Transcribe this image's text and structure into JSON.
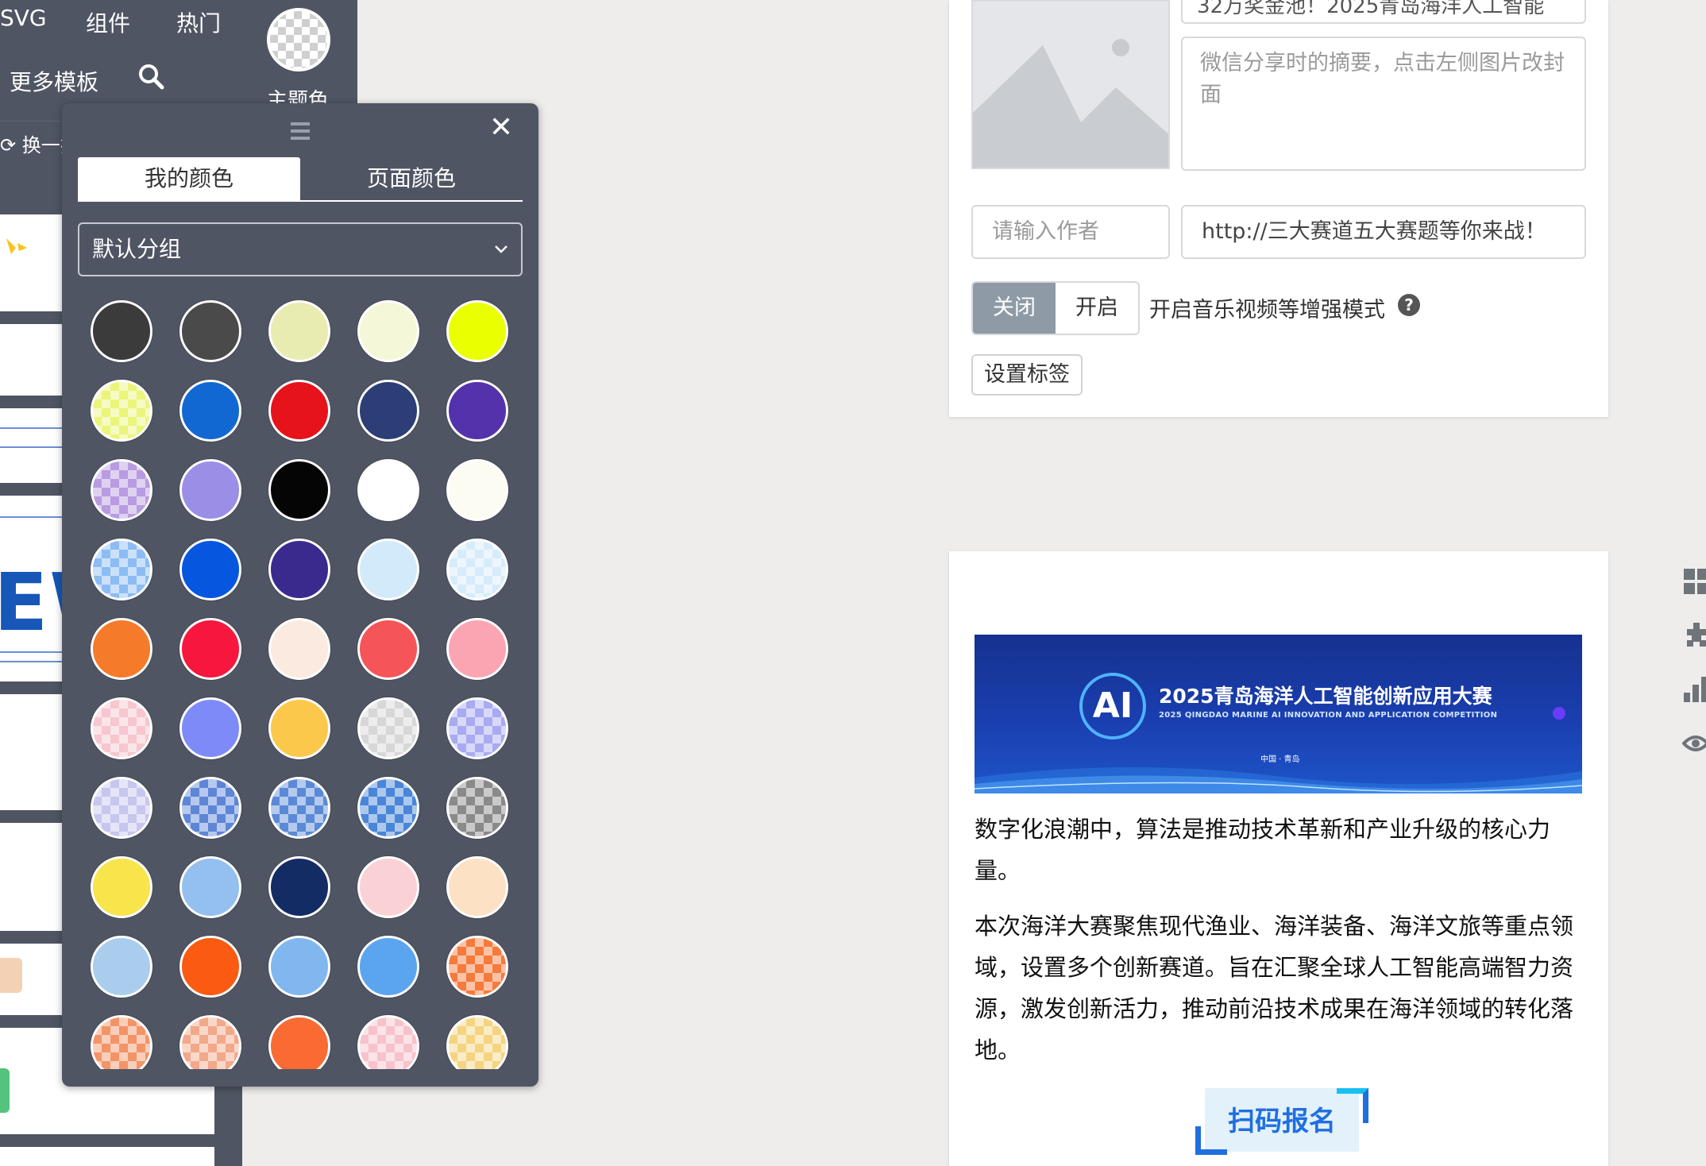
{
  "toolbar": {
    "svg_label": "SVG",
    "components_label": "组件",
    "hot_label": "热门",
    "more_templates_label": "更多模板",
    "theme_color_label": "主题色",
    "refresh_label": "换一换"
  },
  "left_preview": {
    "ews_text": "EWS"
  },
  "color_picker": {
    "tabs": [
      "我的颜色",
      "页面颜色"
    ],
    "active_tab": 0,
    "group_select_value": "默认分组",
    "swatches": [
      {
        "color": "#3b3b3b",
        "pattern": false
      },
      {
        "color": "#4a4a4a",
        "pattern": false
      },
      {
        "color": "#e9ecb0",
        "pattern": false
      },
      {
        "color": "#f5f7d9",
        "pattern": false
      },
      {
        "color": "#eaff00",
        "pattern": false
      },
      {
        "color": "#eaf57a",
        "pattern": true
      },
      {
        "color": "#1268d3",
        "pattern": false
      },
      {
        "color": "#e6131b",
        "pattern": false
      },
      {
        "color": "#2c3e75",
        "pattern": false
      },
      {
        "color": "#5432ac",
        "pattern": false
      },
      {
        "color": "#b89be0",
        "pattern": true
      },
      {
        "color": "#9b8ee6",
        "pattern": false
      },
      {
        "color": "#050505",
        "pattern": false
      },
      {
        "color": "#ffffff",
        "pattern": false
      },
      {
        "color": "#fdfcf3",
        "pattern": false
      },
      {
        "color": "#8cbcf3",
        "pattern": true
      },
      {
        "color": "#0656e0",
        "pattern": false
      },
      {
        "color": "#3a2a8e",
        "pattern": false
      },
      {
        "color": "#d3eafa",
        "pattern": false
      },
      {
        "color": "#d6ecfb",
        "pattern": true
      },
      {
        "color": "#f57a2a",
        "pattern": false
      },
      {
        "color": "#f7163d",
        "pattern": false
      },
      {
        "color": "#fbeadf",
        "pattern": false
      },
      {
        "color": "#f55459",
        "pattern": false
      },
      {
        "color": "#fba5b2",
        "pattern": false
      },
      {
        "color": "#f7c6cf",
        "pattern": true
      },
      {
        "color": "#7e8af7",
        "pattern": false
      },
      {
        "color": "#fcc84b",
        "pattern": false
      },
      {
        "color": "#d7d7d7",
        "pattern": true
      },
      {
        "color": "#a9aaf1",
        "pattern": true
      },
      {
        "color": "#c6c6ee",
        "pattern": true
      },
      {
        "color": "#5e86d6",
        "pattern": true
      },
      {
        "color": "#5a8ad7",
        "pattern": true
      },
      {
        "color": "#4a86d8",
        "pattern": true
      },
      {
        "color": "#8a8a8a",
        "pattern": true
      },
      {
        "color": "#f8e54b",
        "pattern": false
      },
      {
        "color": "#93c0ee",
        "pattern": false
      },
      {
        "color": "#142c64",
        "pattern": false
      },
      {
        "color": "#fad2d6",
        "pattern": false
      },
      {
        "color": "#fde1c4",
        "pattern": false
      },
      {
        "color": "#aacdee",
        "pattern": false
      },
      {
        "color": "#fa5a12",
        "pattern": false
      },
      {
        "color": "#81b7ef",
        "pattern": false
      },
      {
        "color": "#5ba5ef",
        "pattern": false
      },
      {
        "color": "#f57a3c",
        "pattern": true
      },
      {
        "color": "#f29468",
        "pattern": true
      },
      {
        "color": "#f2a88a",
        "pattern": true
      },
      {
        "color": "#f96b32",
        "pattern": false
      },
      {
        "color": "#f7c2cb",
        "pattern": true
      },
      {
        "color": "#f4d480",
        "pattern": true
      }
    ]
  },
  "share_settings": {
    "title_value": "32万奖金池！2025青岛海洋人工智能",
    "summary_placeholder": "微信分享时的摘要，点击左侧图片改封面",
    "author_placeholder": "请输入作者",
    "link_value": "http://三大赛道五大赛题等你来战！",
    "toggle_off_label": "关闭",
    "toggle_on_label": "开启",
    "toggle_state": "off",
    "enhance_label": "开启音乐视频等增强模式",
    "tag_button_label": "设置标签"
  },
  "article": {
    "banner": {
      "logo_text": "AI",
      "title": "2025青岛海洋人工智能创新应用大赛",
      "subtitle": "2025 QINGDAO MARINE AI INNOVATION AND APPLICATION COMPETITION",
      "place": "中国 · 青岛"
    },
    "para1": "数字化浪潮中，算法是推动技术革新和产业升级的核心力量。",
    "para2": "本次海洋大赛聚焦现代渔业、海洋装备、海洋文旅等重点领域，设置多个创新赛道。旨在汇聚全球人工智能高端智力资源，激发创新活力，推动前沿技术成果在海洋领域的转化落地。",
    "scan_button_label": "扫码报名"
  },
  "side_tools": [
    "grid-icon",
    "puzzle-icon",
    "bar-chart-icon",
    "eye-icon"
  ]
}
